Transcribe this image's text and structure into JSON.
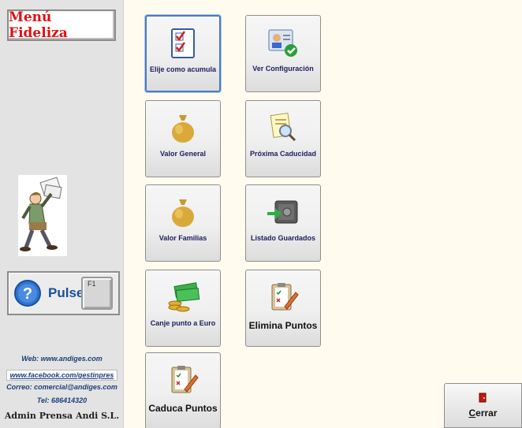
{
  "sidebar": {
    "title": "Menú Fideliza",
    "pulse_label": "Pulse",
    "f1_key": "F1",
    "web": "Web: www.andiges.com",
    "facebook": "www.facebook.com/gestinpres",
    "email": "Correo: comercial@andiges.com",
    "tel": "Tel: 686414320",
    "company": "Admin Prensa Andi S.L."
  },
  "tiles": [
    {
      "label": "Elije como acumula",
      "icon": "checklist-icon"
    },
    {
      "label": "Ver Configuración",
      "icon": "id-card-check-icon"
    },
    {
      "label": "Valor General",
      "icon": "money-bag-icon"
    },
    {
      "label": "Próxima Caducidad",
      "icon": "document-search-icon"
    },
    {
      "label": "Valor Familias",
      "icon": "money-bag-icon"
    },
    {
      "label": "Listado Guardados",
      "icon": "safe-icon"
    },
    {
      "label": "Canje punto a Euro",
      "icon": "cash-coins-icon"
    },
    {
      "label": "Elimina Puntos",
      "icon": "clipboard-edit-icon"
    },
    {
      "label": "Caduca Puntos",
      "icon": "clipboard-edit-icon"
    }
  ],
  "close_button": {
    "label_underlined": "C",
    "label_rest": "errar",
    "icon": "door-exit-icon"
  }
}
